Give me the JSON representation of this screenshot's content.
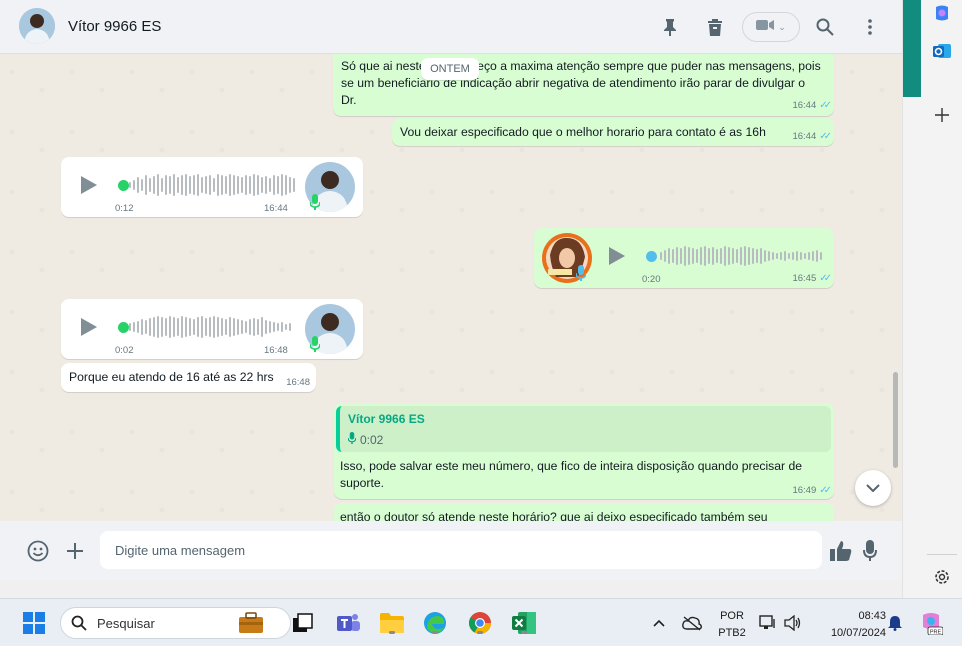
{
  "header": {
    "contact_name": "Vítor 9966 ES",
    "icons": [
      "pin-icon",
      "trash-icon",
      "video-call-icon",
      "search-icon",
      "more-menu-icon"
    ]
  },
  "date_chip": "ONTEM",
  "messages": [
    {
      "type": "text",
      "direction": "out",
      "text": "Só que ai neste horário peço a maxima atenção sempre que puder nas mensagens, pois se um beneficiario de indicação abrir negativa de atendimento irão parar de divulgar o Dr.",
      "time": "16:44",
      "status": "read"
    },
    {
      "type": "text",
      "direction": "out",
      "text": "Vou deixar especificado que o melhor horario para contato é as 16h",
      "time": "16:44",
      "status": "read"
    },
    {
      "type": "voice",
      "direction": "in",
      "duration": "0:12",
      "time": "16:44"
    },
    {
      "type": "voice",
      "direction": "out",
      "duration": "0:20",
      "time": "16:45",
      "status": "read"
    },
    {
      "type": "voice",
      "direction": "in",
      "duration": "0:02",
      "time": "16:48"
    },
    {
      "type": "text",
      "direction": "in",
      "text": "Porque eu atendo de 16 até as 22 hrs",
      "time": "16:48"
    },
    {
      "type": "reply",
      "direction": "out",
      "quoted_author": "Vítor 9966 ES",
      "quoted_text": "0:02",
      "text": "Isso, pode salvar este meu número, que fico de inteira disposição quando precisar de suporte.",
      "time": "16:49",
      "status": "read"
    },
    {
      "type": "text",
      "direction": "out",
      "text": "então o doutor só atende neste horário? que ai deixo especificado também seu"
    }
  ],
  "composer": {
    "placeholder": "Digite uma mensagem",
    "icons": [
      "emoji-icon",
      "attach-plus-icon",
      "thumbs-up-icon",
      "mic-icon"
    ]
  },
  "side_panel": {
    "icons": [
      "copilot-icon",
      "outlook-icon",
      "add-icon",
      "settings-icon"
    ]
  },
  "taskbar": {
    "search_label": "Pesquisar",
    "language_line1": "POR",
    "language_line2": "PTB2",
    "clock_time": "08:43",
    "clock_date": "10/07/2024",
    "apps": [
      "windows-start-icon",
      "work-briefcase-icon",
      "task-view-icon",
      "teams-icon",
      "file-explorer-icon",
      "edge-icon",
      "chrome-icon",
      "excel-icon"
    ]
  },
  "colors": {
    "outgoing_bubble": "#d9fdd3",
    "incoming_bubble": "#ffffff",
    "chat_background": "#efeae2",
    "read_ticks": "#53bdeb",
    "accent_green": "#06cf9c",
    "quote_author": "#06a884"
  }
}
